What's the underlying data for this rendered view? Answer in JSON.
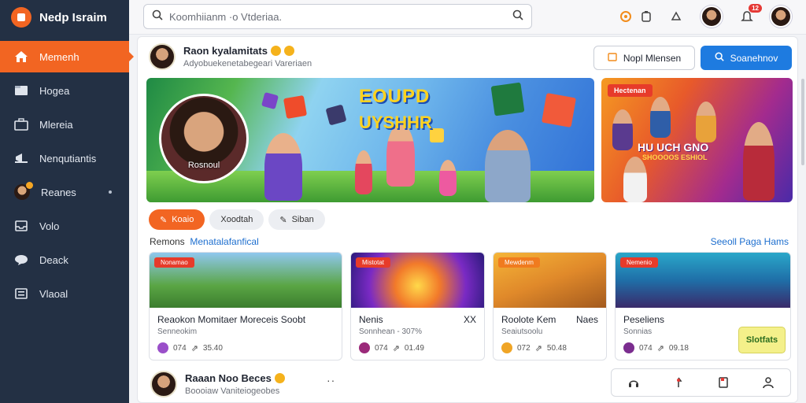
{
  "app": {
    "name": "Nedp Israim"
  },
  "sidebar": {
    "items": [
      {
        "label": "Memenh",
        "icon": "home-icon",
        "active": true
      },
      {
        "label": "Hogea",
        "icon": "folder-icon"
      },
      {
        "label": "Mlereia",
        "icon": "briefcase-icon"
      },
      {
        "label": "Nenqutiantis",
        "icon": "megaphone-icon"
      },
      {
        "label": "Reanes",
        "icon": "user-avatar-icon"
      },
      {
        "label": "Volo",
        "icon": "inbox-icon"
      },
      {
        "label": "Deack",
        "icon": "chat-icon"
      },
      {
        "label": "Vlaoal",
        "icon": "list-icon"
      }
    ]
  },
  "topbar": {
    "search_placeholder": "Koomhiianm ·o Vtderiaa.",
    "notification_count": "12"
  },
  "profile": {
    "name": "Raon kyalamitats",
    "subtitle": "Adyobuekenetabegeari Vareriaen"
  },
  "header_buttons": {
    "secondary": "Nopl Mlensen",
    "primary": "Soanehnov"
  },
  "hero": {
    "portrait_caption": "Rosnoul",
    "title_line1": "EOUPD",
    "title_line2": "UYSHHR"
  },
  "promo": {
    "tag": "Hectenan",
    "title": "HU UCH GNO",
    "subtitle": "SHOOOOS ESHIOL"
  },
  "chips": [
    {
      "label": "Koaio",
      "icon": "pencil-icon",
      "active": true
    },
    {
      "label": "Xoodtah",
      "icon": "",
      "active": false
    },
    {
      "label": "Siban",
      "icon": "edit-icon",
      "active": false
    }
  ],
  "section": {
    "title_plain": "Remons",
    "title_link": "Menatalafanfical",
    "see_all": "Seeoll Paga Hams"
  },
  "cards": [
    {
      "tag": "Nonamao",
      "title": "Reaokon Momitaer Moreceis Soobt",
      "extra": "",
      "sub": "Senneokim",
      "views": "074",
      "shares": "35.40",
      "dot": "#9a4fc9"
    },
    {
      "tag": "Mistotat",
      "title": "Nenis",
      "extra": "XX",
      "sub": "Sonnhean - 307%",
      "views": "074",
      "shares": "01.49",
      "dot": "#9b2a7a"
    },
    {
      "tag": "Mewdenm",
      "title": "Roolote Kem",
      "extra": "Naes",
      "sub": "Seaiutsoolu",
      "views": "072",
      "shares": "50.48",
      "dot": "#f0a526"
    },
    {
      "tag": "Nemenio",
      "title": "Peseliens",
      "extra": "",
      "sub": "Sonnias",
      "views": "074",
      "shares": "09.18",
      "dot": "#7b2d8f",
      "sticker": "Slotfats"
    }
  ],
  "feed": {
    "name": "Raaan Noo Beces",
    "subtitle": "Boooiaw Vaniteiogeobes"
  }
}
